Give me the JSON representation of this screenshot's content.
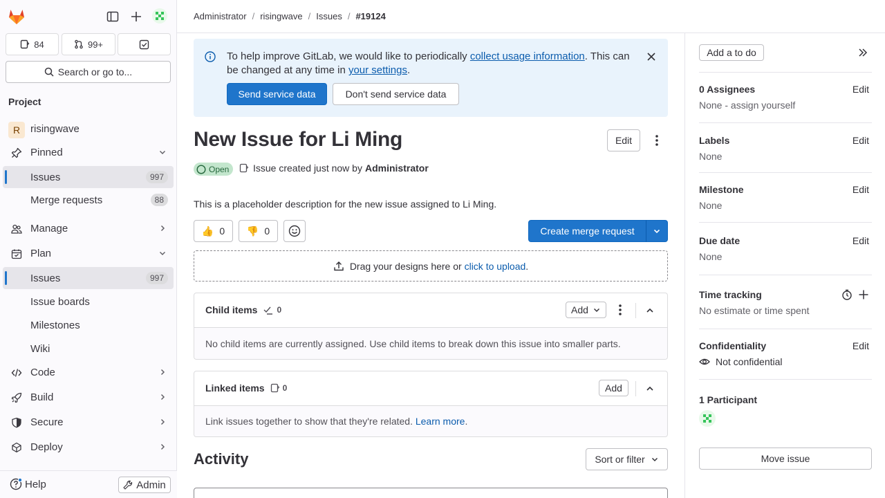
{
  "colors": {
    "accent": "#1f75cb",
    "banner_bg": "#e9f3fc",
    "open_badge_bg": "#c3e6cd",
    "link": "#0b5cad"
  },
  "sidebar": {
    "counters": {
      "issues": "84",
      "merge_requests": "99+"
    },
    "search_label": "Search or go to...",
    "section_heading": "Project",
    "project_initial": "R",
    "project_name": "risingwave",
    "pinned": {
      "label": "Pinned",
      "items": [
        {
          "label": "Issues",
          "count": "997"
        },
        {
          "label": "Merge requests",
          "count": "88"
        }
      ]
    },
    "manage": "Manage",
    "plan": {
      "label": "Plan",
      "items": [
        {
          "label": "Issues",
          "count": "997"
        },
        {
          "label": "Issue boards"
        },
        {
          "label": "Milestones"
        },
        {
          "label": "Wiki"
        }
      ]
    },
    "code": "Code",
    "build": "Build",
    "secure": "Secure",
    "deploy": "Deploy",
    "help": "Help",
    "admin": "Admin"
  },
  "breadcrumb": [
    "Administrator",
    "risingwave",
    "Issues",
    "#19124"
  ],
  "banner": {
    "text_1": "To help improve GitLab, we would like to periodically ",
    "link_1": "collect usage information",
    "text_2": ". This can be changed at any time in ",
    "link_2": "your settings",
    "text_3": ".",
    "primary": "Send service data",
    "secondary": "Don't send service data"
  },
  "issue": {
    "title": "New Issue for Li Ming",
    "edit": "Edit",
    "status": "Open",
    "created_text": "Issue created just now by",
    "author": "Administrator",
    "description": "This is a placeholder description for the new issue assigned to Li Ming.",
    "thumbs_up": "0",
    "thumbs_down": "0",
    "create_mr": "Create merge request",
    "drop_text": "Drag your designs here or",
    "drop_link": "click to upload",
    "drop_end": "."
  },
  "child_items": {
    "title": "Child items",
    "count": "0",
    "add": "Add",
    "empty": "No child items are currently assigned. Use child items to break down this issue into smaller parts."
  },
  "linked_items": {
    "title": "Linked items",
    "count": "0",
    "add": "Add",
    "empty": "Link issues together to show that they're related.",
    "learn_more": "Learn more",
    "end": "."
  },
  "activity": {
    "title": "Activity",
    "sort": "Sort or filter"
  },
  "right": {
    "todo": "Add a to do",
    "assignees": {
      "title": "0 Assignees",
      "edit": "Edit",
      "value": "None - assign yourself"
    },
    "labels": {
      "title": "Labels",
      "edit": "Edit",
      "value": "None"
    },
    "milestone": {
      "title": "Milestone",
      "edit": "Edit",
      "value": "None"
    },
    "due": {
      "title": "Due date",
      "edit": "Edit",
      "value": "None"
    },
    "time": {
      "title": "Time tracking",
      "value": "No estimate or time spent"
    },
    "confidentiality": {
      "title": "Confidentiality",
      "edit": "Edit",
      "value": "Not confidential"
    },
    "participants": {
      "title": "1 Participant"
    },
    "move": "Move issue"
  }
}
